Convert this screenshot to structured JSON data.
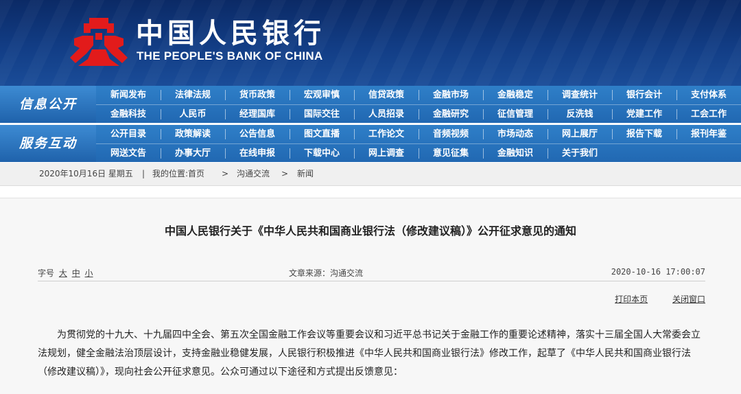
{
  "header": {
    "title_cn": "中国人民银行",
    "title_en": "THE PEOPLE'S BANK OF CHINA",
    "logo_icon": "pboc-logo-icon",
    "brand_color": "#e21b1b"
  },
  "nav": {
    "section1_label": "信息公开",
    "section2_label": "服务互动",
    "section1_row1": [
      "新闻发布",
      "法律法规",
      "货币政策",
      "宏观审慎",
      "信贷政策",
      "金融市场",
      "金融稳定",
      "调查统计",
      "银行会计",
      "支付体系"
    ],
    "section1_row2": [
      "金融科技",
      "人民币",
      "经理国库",
      "国际交往",
      "人员招录",
      "金融研究",
      "征信管理",
      "反洗钱",
      "党建工作",
      "工会工作"
    ],
    "section2_row1": [
      "公开目录",
      "政策解读",
      "公告信息",
      "图文直播",
      "工作论文",
      "音频视频",
      "市场动态",
      "网上展厅",
      "报告下载",
      "报刊年鉴"
    ],
    "section2_row2": [
      "网送文告",
      "办事大厅",
      "在线申报",
      "下载中心",
      "网上调查",
      "意见征集",
      "金融知识",
      "关于我们"
    ]
  },
  "breadcrumb": {
    "date": "2020年10月16日 星期五",
    "sep": "|",
    "location": "我的位置:首页",
    "arrow1": ">",
    "level1": "沟通交流",
    "arrow2": ">",
    "level2": "新闻"
  },
  "article": {
    "title": "中国人民银行关于《中华人民共和国商业银行法（修改建议稿）》公开征求意见的通知",
    "font_size_label": "字号",
    "font_large": "大",
    "font_medium": "中",
    "font_small": "小",
    "source": "文章来源：沟通交流",
    "datetime": "2020-10-16 17:00:07",
    "print_label": "打印本页",
    "close_label": "关闭窗口",
    "body": "为贯彻党的十九大、十九届四中全会、第五次全国金融工作会议等重要会议和习近平总书记关于金融工作的重要论述精神，落实十三届全国人大常委会立法规划，健全金融法治顶层设计，支持金融业稳健发展，人民银行积极推进《中华人民共和国商业银行法》修改工作，起草了《中华人民共和国商业银行法（修改建议稿）》，现向社会公开征求意见。公众可通过以下途径和方式提出反馈意见："
  }
}
